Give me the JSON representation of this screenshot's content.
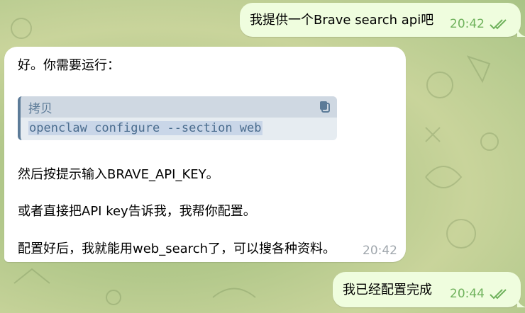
{
  "messages": [
    {
      "direction": "outgoing",
      "text": "我提供一个Brave search api吧",
      "time": "20:42",
      "status": "read"
    },
    {
      "direction": "incoming",
      "intro": "好。你需要运行：",
      "code": {
        "label": "拷贝",
        "command": "openclaw configure --section web"
      },
      "paragraphs": [
        "然后按提示输入BRAVE_API_KEY。",
        "或者直接把API key告诉我，我帮你配置。",
        "配置好后，我就能用web_search了，可以搜各种资料。"
      ],
      "time": "20:42"
    },
    {
      "direction": "outgoing",
      "text": "我已经配置完成",
      "time": "20:44",
      "status": "read"
    }
  ],
  "colors": {
    "outgoing_bubble": "#effdde",
    "incoming_bubble": "#ffffff",
    "outgoing_time": "#6fb25c",
    "code_accent": "#5c7b98"
  },
  "icons": {
    "read_status": "double-check-icon",
    "copy": "copy-icon"
  }
}
